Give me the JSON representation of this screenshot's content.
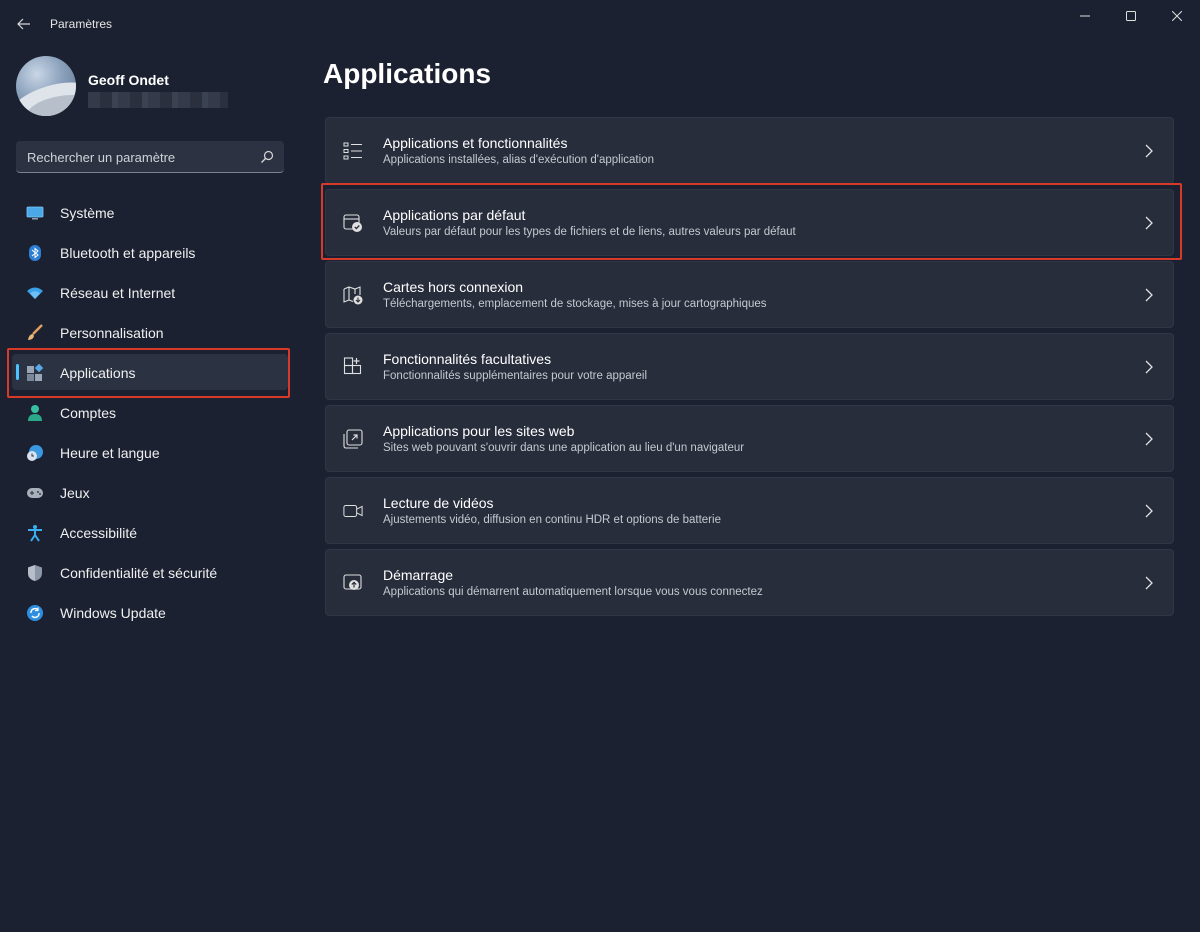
{
  "window": {
    "title": "Paramètres",
    "controls": {
      "minimize": "minimize-icon",
      "maximize": "maximize-icon",
      "close": "close-icon"
    }
  },
  "profile": {
    "name": "Geoff Ondet"
  },
  "search": {
    "placeholder": "Rechercher un paramètre"
  },
  "sidebar": {
    "items": [
      {
        "label": "Système",
        "icon": "monitor-icon"
      },
      {
        "label": "Bluetooth et appareils",
        "icon": "bluetooth-icon"
      },
      {
        "label": "Réseau et Internet",
        "icon": "wifi-icon"
      },
      {
        "label": "Personnalisation",
        "icon": "brush-icon"
      },
      {
        "label": "Applications",
        "icon": "apps-icon",
        "selected": true
      },
      {
        "label": "Comptes",
        "icon": "person-icon"
      },
      {
        "label": "Heure et langue",
        "icon": "globe-clock-icon"
      },
      {
        "label": "Jeux",
        "icon": "gamepad-icon"
      },
      {
        "label": "Accessibilité",
        "icon": "accessibility-icon"
      },
      {
        "label": "Confidentialité et sécurité",
        "icon": "shield-icon"
      },
      {
        "label": "Windows Update",
        "icon": "update-icon"
      }
    ]
  },
  "main": {
    "title": "Applications",
    "cards": [
      {
        "title": "Applications et fonctionnalités",
        "subtitle": "Applications installées, alias d'exécution d'application",
        "icon": "list-icon"
      },
      {
        "title": "Applications par défaut",
        "subtitle": "Valeurs par défaut pour les types de fichiers et de liens, autres valeurs par défaut",
        "icon": "default-app-icon"
      },
      {
        "title": "Cartes hors connexion",
        "subtitle": "Téléchargements, emplacement de stockage, mises à jour cartographiques",
        "icon": "map-download-icon"
      },
      {
        "title": "Fonctionnalités facultatives",
        "subtitle": "Fonctionnalités supplémentaires pour votre appareil",
        "icon": "add-grid-icon"
      },
      {
        "title": "Applications pour les sites web",
        "subtitle": "Sites web pouvant s'ouvrir dans une application au lieu d'un navigateur",
        "icon": "open-in-app-icon"
      },
      {
        "title": "Lecture de vidéos",
        "subtitle": "Ajustements vidéo, diffusion en continu HDR et options de batterie",
        "icon": "video-icon"
      },
      {
        "title": "Démarrage",
        "subtitle": "Applications qui démarrent automatiquement lorsque vous vous connectez",
        "icon": "startup-icon"
      }
    ]
  },
  "colors": {
    "accent": "#4cc2ff",
    "highlight": "#d83a2a",
    "background": "#1b2130",
    "card": "#272d3b"
  }
}
